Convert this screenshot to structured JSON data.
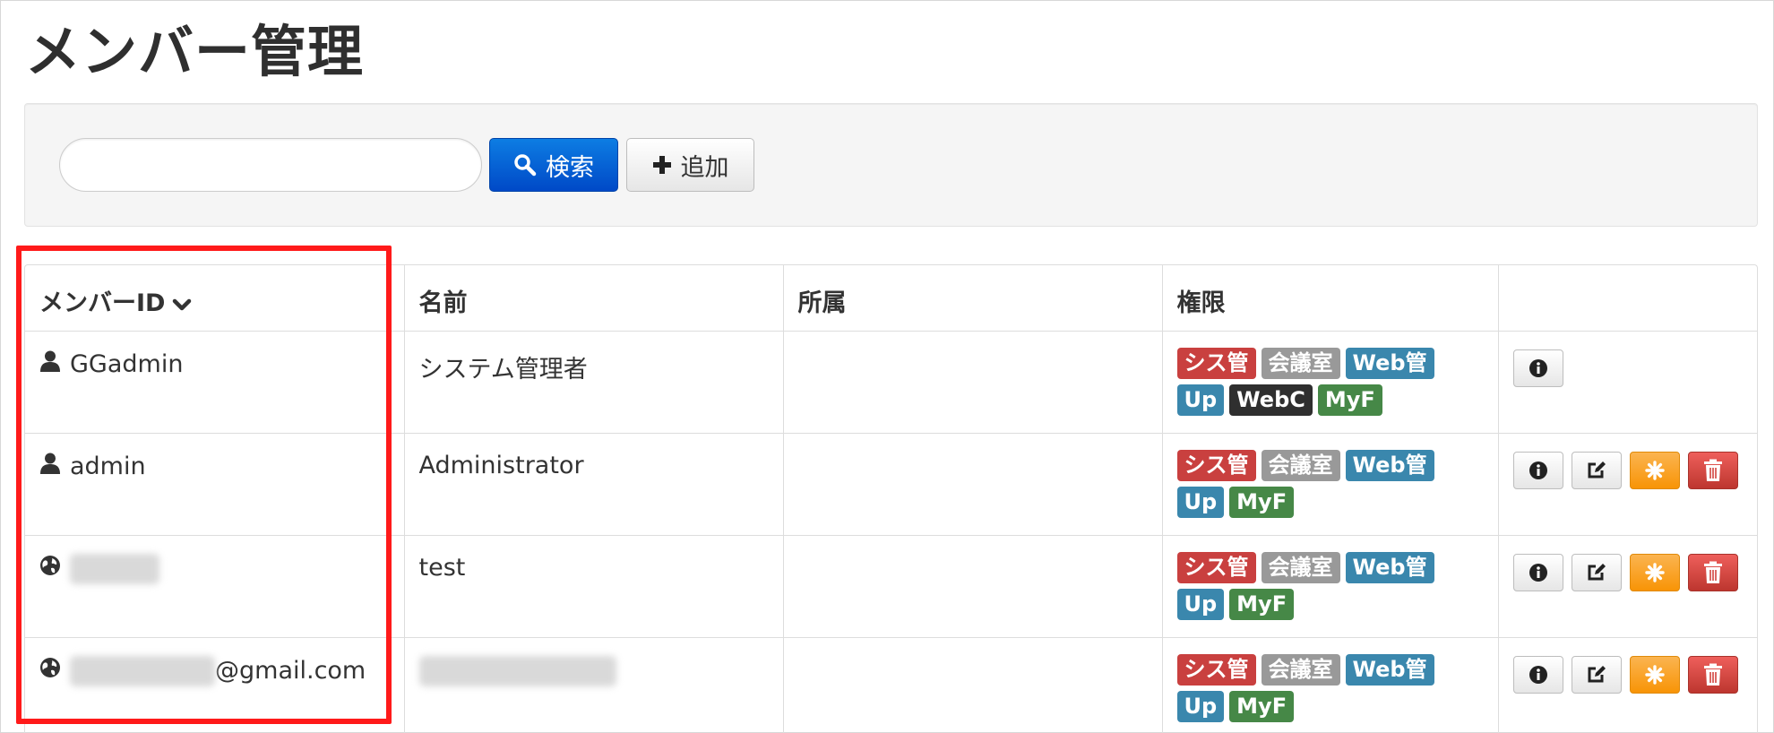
{
  "page": {
    "title": "メンバー管理"
  },
  "search": {
    "input_value": "",
    "search_label": "検索",
    "add_label": "追加"
  },
  "table": {
    "headers": [
      "メンバーID",
      "名前",
      "所属",
      "権限",
      ""
    ],
    "rows": [
      {
        "id_icon": "user-icon",
        "member_id": "GGadmin",
        "id_suffix": "",
        "name": "システム管理者",
        "affiliation": "",
        "roles": [
          "シス管",
          "会議室",
          "Web管",
          "Up",
          "WebC",
          "MyF"
        ],
        "actions": [
          "info"
        ]
      },
      {
        "id_icon": "user-icon",
        "member_id": "admin",
        "id_suffix": "",
        "name": "Administrator",
        "affiliation": "",
        "roles": [
          "シス管",
          "会議室",
          "Web管",
          "Up",
          "MyF"
        ],
        "actions": [
          "info",
          "edit",
          "reset",
          "delete"
        ]
      },
      {
        "id_icon": "globe-icon",
        "member_id": "",
        "id_suffix": "",
        "name": "test",
        "affiliation": "",
        "roles": [
          "シス管",
          "会議室",
          "Web管",
          "Up",
          "MyF"
        ],
        "actions": [
          "info",
          "edit",
          "reset",
          "delete"
        ]
      },
      {
        "id_icon": "globe-icon",
        "member_id": "",
        "id_suffix": "@gmail.com",
        "name": "",
        "affiliation": "",
        "roles": [
          "シス管",
          "会議室",
          "Web管",
          "Up",
          "MyF"
        ],
        "actions": [
          "info",
          "edit",
          "reset",
          "delete"
        ]
      }
    ]
  },
  "role_colors": {
    "シス管": "#c9403f",
    "会議室": "#999999",
    "Web管": "#3a87ad",
    "Up": "#3a87ad",
    "WebC": "#2f2f2f",
    "MyF": "#468847"
  },
  "colors": {
    "primary": "#0a66d6",
    "highlight_border": "#ff1a1a"
  }
}
